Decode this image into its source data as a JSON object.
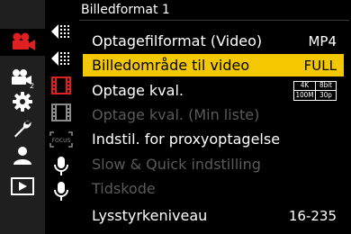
{
  "menu": {
    "title": "Billedformat 1",
    "items": [
      {
        "label": "Optagefilformat (Video)",
        "value": "MP4",
        "state": "normal"
      },
      {
        "label": "Billedområde til video",
        "value": "FULL",
        "state": "selected"
      },
      {
        "label": "Optage kval.",
        "value": "",
        "state": "normal"
      },
      {
        "label": "Optage kval. (Min liste)",
        "value": "",
        "state": "disabled"
      },
      {
        "label": "Indstil. for proxyoptagelse",
        "value": "",
        "state": "normal"
      },
      {
        "label": "Slow & Quick indstilling",
        "value": "",
        "state": "disabled"
      },
      {
        "label": "Tidskode",
        "value": "",
        "state": "disabled"
      },
      {
        "label": "Lysstyrkeniveau",
        "value": "16-235",
        "state": "normal"
      }
    ],
    "quality_badge": {
      "resolution": "4K",
      "bitdepth": "8bit",
      "bitrate": "100M",
      "framerate": "30p"
    }
  },
  "left_tabs": [
    {
      "icon": "video-camera-icon",
      "active": true
    },
    {
      "icon": "video-camera-2-icon",
      "active": false
    },
    {
      "icon": "gear-icon",
      "active": false
    },
    {
      "icon": "wrench-icon",
      "active": false
    },
    {
      "icon": "person-icon",
      "active": false
    },
    {
      "icon": "playback-icon",
      "active": false
    }
  ],
  "sub_tabs": [
    {
      "icon": "image-format-1-icon",
      "active": true
    },
    {
      "icon": "image-format-2-icon",
      "active": false
    },
    {
      "icon": "film-strip-red-icon",
      "active": false
    },
    {
      "icon": "film-strip-icon",
      "active": false
    },
    {
      "icon": "focus-icon",
      "active": false,
      "label": "FOCUS"
    },
    {
      "icon": "microphone-icon",
      "active": false
    },
    {
      "icon": "microphone-2-icon",
      "active": false
    }
  ],
  "colors": {
    "accent": "#f4c800",
    "active_tab_icon": "#e02020",
    "disabled_text": "#5a5a5a",
    "sidebar_bg": "#1f1f1f"
  }
}
